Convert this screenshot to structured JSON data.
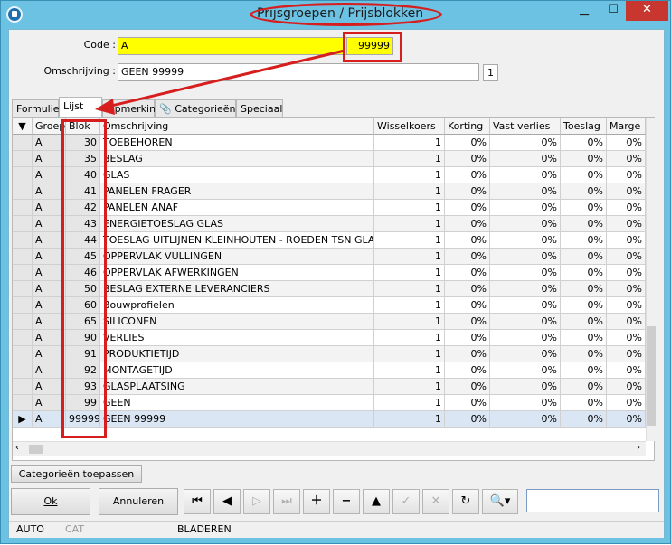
{
  "window": {
    "title": "Prijsgroepen / Prijsblokken"
  },
  "form": {
    "code_label": "Code :",
    "code_value": "A",
    "code_block_value": "99999",
    "omschrijving_label": "Omschrijving :",
    "omschrijving_value": "GEEN 99999",
    "counter": "1"
  },
  "tabs": [
    "Formulier",
    "Lijst",
    "Opmerking",
    "Categorieën",
    "Speciaal"
  ],
  "grid": {
    "columns": [
      "Groep",
      "Blok",
      "Omschrijving",
      "Wisselkoers",
      "Korting",
      "Vast verlies",
      "Toeslag",
      "Marge"
    ],
    "rows": [
      [
        "A",
        "30",
        "TOEBEHOREN",
        "1",
        "0%",
        "0%",
        "0%",
        "0%"
      ],
      [
        "A",
        "35",
        "BESLAG",
        "1",
        "0%",
        "0%",
        "0%",
        "0%"
      ],
      [
        "A",
        "40",
        "GLAS",
        "1",
        "0%",
        "0%",
        "0%",
        "0%"
      ],
      [
        "A",
        "41",
        "PANELEN FRAGER",
        "1",
        "0%",
        "0%",
        "0%",
        "0%"
      ],
      [
        "A",
        "42",
        "PANELEN ANAF",
        "1",
        "0%",
        "0%",
        "0%",
        "0%"
      ],
      [
        "A",
        "43",
        "ENERGIETOESLAG GLAS",
        "1",
        "0%",
        "0%",
        "0%",
        "0%"
      ],
      [
        "A",
        "44",
        "TOESLAG UITLIJNEN KLEINHOUTEN - ROEDEN TSN GLAS",
        "1",
        "0%",
        "0%",
        "0%",
        "0%"
      ],
      [
        "A",
        "45",
        "OPPERVLAK VULLINGEN",
        "1",
        "0%",
        "0%",
        "0%",
        "0%"
      ],
      [
        "A",
        "46",
        "OPPERVLAK AFWERKINGEN",
        "1",
        "0%",
        "0%",
        "0%",
        "0%"
      ],
      [
        "A",
        "50",
        "BESLAG EXTERNE LEVERANCIERS",
        "1",
        "0%",
        "0%",
        "0%",
        "0%"
      ],
      [
        "A",
        "60",
        "Bouwprofielen",
        "1",
        "0%",
        "0%",
        "0%",
        "0%"
      ],
      [
        "A",
        "65",
        "SILICONEN",
        "1",
        "0%",
        "0%",
        "0%",
        "0%"
      ],
      [
        "A",
        "90",
        "VERLIES",
        "1",
        "0%",
        "0%",
        "0%",
        "0%"
      ],
      [
        "A",
        "91",
        "PRODUKTIETIJD",
        "1",
        "0%",
        "0%",
        "0%",
        "0%"
      ],
      [
        "A",
        "92",
        "MONTAGETIJD",
        "1",
        "0%",
        "0%",
        "0%",
        "0%"
      ],
      [
        "A",
        "93",
        "GLASPLAATSING",
        "1",
        "0%",
        "0%",
        "0%",
        "0%"
      ],
      [
        "A",
        "99",
        "GEEN",
        "1",
        "0%",
        "0%",
        "0%",
        "0%"
      ],
      [
        "A",
        "99999",
        "GEEN 99999",
        "1",
        "0%",
        "0%",
        "0%",
        "0%"
      ]
    ],
    "selected_row": 17
  },
  "buttons": {
    "categorieen_toepassen": "Categorieën toepassen",
    "ok": "Ok",
    "annuleren": "Annuleren"
  },
  "status": {
    "auto": "AUTO",
    "cat": "CAT",
    "mode": "BLADEREN"
  },
  "colors": {
    "highlight_yellow": "#ffff00",
    "annotation_red": "#d61e1e",
    "window_frame": "#6cc2e2"
  },
  "icons": [
    "app-icon",
    "minimize-icon",
    "maximize-icon",
    "close-icon",
    "paperclip-icon",
    "first-record-icon",
    "prev-record-icon",
    "next-record-icon",
    "last-record-icon",
    "add-icon",
    "delete-icon",
    "edit-icon",
    "confirm-icon",
    "cancel-icon",
    "refresh-icon",
    "search-icon"
  ]
}
